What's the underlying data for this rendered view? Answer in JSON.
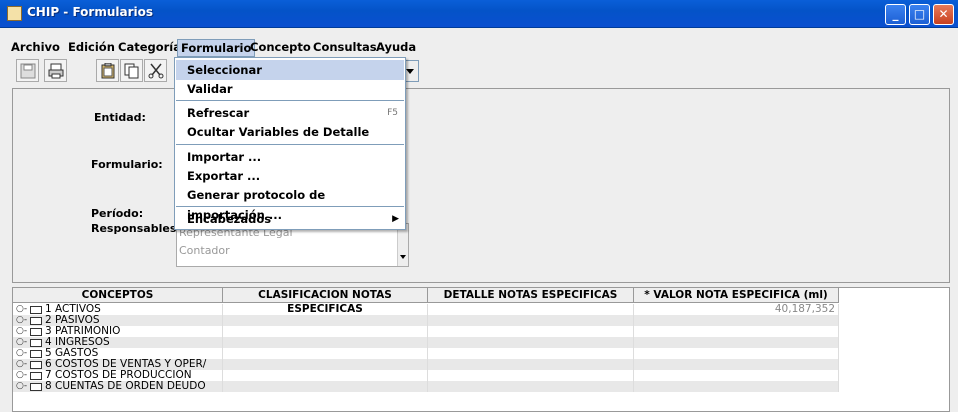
{
  "window": {
    "title": "CHIP - Formularios"
  },
  "menubar": [
    "Archivo",
    "Edición",
    "Categoría",
    "Formulario",
    "Concepto",
    "Consultas",
    "Ayuda"
  ],
  "dropdown": {
    "items": [
      {
        "label": "Seleccionar",
        "shortcut": ""
      },
      {
        "label": "Validar",
        "shortcut": ""
      },
      {
        "label": "Refrescar",
        "shortcut": "F5"
      },
      {
        "label": "Ocultar Variables de Detalle",
        "shortcut": ""
      },
      {
        "label": "Importar ...",
        "shortcut": ""
      },
      {
        "label": "Exportar ...",
        "shortcut": ""
      },
      {
        "label": "Generar protocolo de importación ...",
        "shortcut": ""
      },
      {
        "label": "Encabezados",
        "shortcut": ""
      }
    ]
  },
  "form": {
    "entidad_label": "Entidad:",
    "formulario_label": "Formulario:",
    "periodo_label": "Período:",
    "responsables_label": "Responsables:",
    "responsables": [
      "Representante Legal",
      "Contador"
    ]
  },
  "table": {
    "headers": [
      "CONCEPTOS",
      "CLASIFICACION NOTAS ESPECIFICAS",
      "DETALLE NOTAS ESPECIFICAS",
      "* VALOR NOTA ESPECIFICA (ml)"
    ],
    "rows": [
      {
        "name": "1 ACTIVOS",
        "value": "40,187,352"
      },
      {
        "name": "2 PASIVOS",
        "value": ""
      },
      {
        "name": "3 PATRIMONIO",
        "value": ""
      },
      {
        "name": "4 INGRESOS",
        "value": ""
      },
      {
        "name": "5 GASTOS",
        "value": ""
      },
      {
        "name": "6 COSTOS DE VENTAS Y OPER/",
        "value": ""
      },
      {
        "name": "7 COSTOS DE PRODUCCIÓN",
        "value": ""
      },
      {
        "name": "8 CUENTAS DE ORDEN DEUDO",
        "value": ""
      }
    ]
  }
}
